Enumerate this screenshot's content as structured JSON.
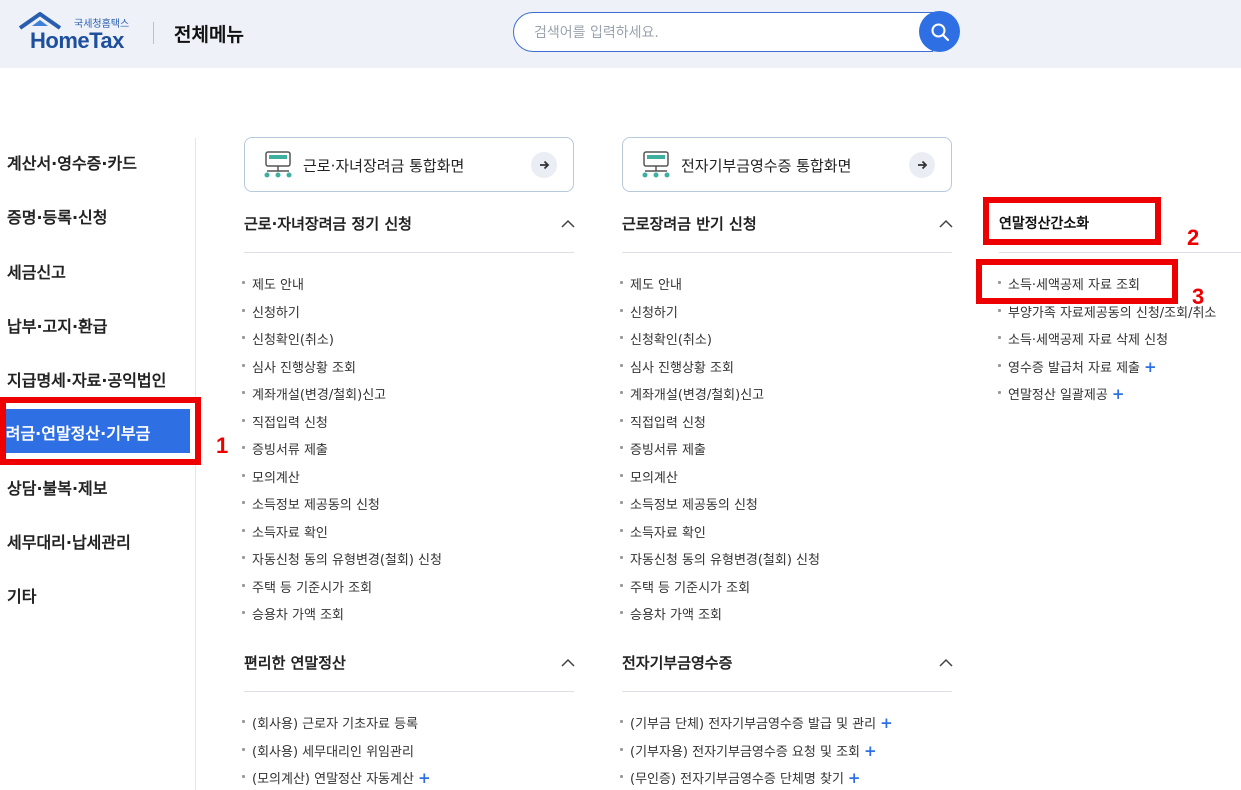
{
  "header": {
    "logo_small": "국세청홈택스",
    "logo_big": "HomeTax",
    "menu_title": "전체메뉴",
    "search_placeholder": "검색어를 입력하세요."
  },
  "left_nav": {
    "items": [
      "계산서·영수증·카드",
      "증명·등록·신청",
      "세금신고",
      "납부·고지·환급",
      "지급명세·자료·공익법인",
      "장려금·연말정산·기부금",
      "상담·불복·제보",
      "세무대리·납세관리",
      "기타"
    ]
  },
  "cards": [
    {
      "label": "근로·자녀장려금 통합화면"
    },
    {
      "label": "전자기부금영수증 통합화면"
    }
  ],
  "col1": {
    "section1_title": "근로·자녀장려금 정기 신청",
    "section1_items": [
      "제도 안내",
      "신청하기",
      "신청확인(취소)",
      "심사 진행상황 조회",
      "계좌개설(변경/철회)신고",
      "직접입력 신청",
      "증빙서류 제출",
      "모의계산",
      "소득정보 제공동의 신청",
      "소득자료 확인",
      "자동신청 동의 유형변경(철회) 신청",
      "주택 등 기준시가 조회",
      "승용차 가액 조회"
    ],
    "section2_title": "편리한 연말정산",
    "section2_items": [
      "(회사용) 근로자 기초자료 등록",
      "(회사용) 세무대리인 위임관리",
      "(모의계산) 연말정산 자동계산"
    ]
  },
  "col2": {
    "section1_title": "근로장려금 반기 신청",
    "section1_items": [
      "제도 안내",
      "신청하기",
      "신청확인(취소)",
      "심사 진행상황 조회",
      "계좌개설(변경/철회)신고",
      "직접입력 신청",
      "증빙서류 제출",
      "모의계산",
      "소득정보 제공동의 신청",
      "소득자료 확인",
      "자동신청 동의 유형변경(철회) 신청",
      "주택 등 기준시가 조회",
      "승용차 가액 조회"
    ],
    "section2_title": "전자기부금영수증",
    "section2_items": [
      "(기부금 단체) 전자기부금영수증 발급 및 관리",
      "(기부자용) 전자기부금영수증 요청 및 조회",
      "(무인증) 전자기부금영수증 단체명 찾기"
    ]
  },
  "col3": {
    "title": "연말정산간소화",
    "items": [
      "소득·세액공제 자료 조회",
      "부양가족 자료제공동의 신청/조회/취소",
      "소득·세액공제 자료 삭제 신청",
      "영수증 발급처 자료 제출",
      "연말정산 일괄제공"
    ]
  },
  "annotations": {
    "n1": "1",
    "n2": "2",
    "n3": "3"
  },
  "colors": {
    "accent": "#2f6fe4",
    "annotation": "#ee0000",
    "header_bg": "#eef2f8"
  },
  "plus_symbol": "+"
}
